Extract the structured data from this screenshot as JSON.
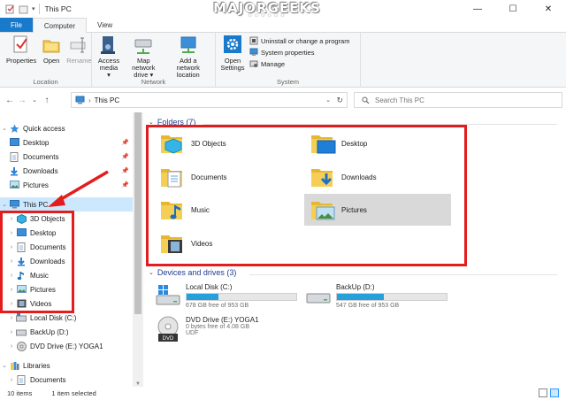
{
  "window": {
    "title": "This PC"
  },
  "watermark": {
    "text": "MAJORGEEKS",
    "stars": "★★★★★★"
  },
  "window_buttons": {
    "minimize": "—",
    "maximize": "☐",
    "close": "✕"
  },
  "tabs": [
    {
      "label": "File"
    },
    {
      "label": "Computer"
    },
    {
      "label": "View"
    }
  ],
  "ribbon": {
    "location": {
      "label": "Location",
      "properties": "Properties",
      "open": "Open",
      "rename": "Rename"
    },
    "network": {
      "label": "Network",
      "access_media": "Access media ▾",
      "map_network_drive": "Map network drive ▾",
      "add_network_location": "Add a network location"
    },
    "system": {
      "label": "System",
      "open_settings": "Open Settings",
      "uninstall": "Uninstall or change a program",
      "system_properties": "System properties",
      "manage": "Manage"
    }
  },
  "address": {
    "path": "This PC",
    "search_placeholder": "Search This PC"
  },
  "nav": {
    "quick_access": "Quick access",
    "quick_items": [
      "Desktop",
      "Documents",
      "Downloads",
      "Pictures"
    ],
    "this_pc": "This PC",
    "pc_items": [
      "3D Objects",
      "Desktop",
      "Documents",
      "Downloads",
      "Music",
      "Pictures",
      "Videos"
    ],
    "drives": [
      "Local Disk (C:)",
      "BackUp (D:)",
      "DVD Drive (E:) YOGA1"
    ],
    "libraries": "Libraries",
    "library_items": [
      "Documents"
    ]
  },
  "folders": {
    "header": "Folders (7)",
    "items": [
      "3D Objects",
      "Desktop",
      "Documents",
      "Downloads",
      "Music",
      "Pictures",
      "Videos"
    ]
  },
  "devices": {
    "header": "Devices and drives (3)",
    "drives": [
      {
        "name": "Local Disk (C:)",
        "free": "678 GB free of 953 GB",
        "used_fraction": 0.29
      },
      {
        "name": "BackUp (D:)",
        "free": "547 GB free of 953 GB",
        "used_fraction": 0.43
      },
      {
        "name": "DVD Drive (E:) YOGA1",
        "free": "0 bytes free of 4.08 GB",
        "fs": "UDF",
        "dvd_label": "DVD"
      }
    ]
  },
  "status": {
    "items": "10 items",
    "selected": "1 item selected"
  },
  "colors": {
    "accent": "#1979ca",
    "highlight": "#e31d1d",
    "selection": "#cce8ff",
    "drive_bar": "#26a0da"
  }
}
